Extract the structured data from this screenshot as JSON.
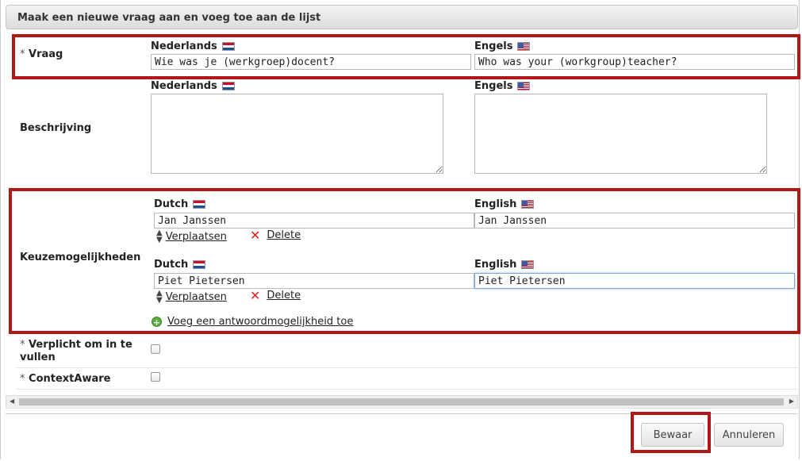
{
  "dialog": {
    "title": "Maak een nieuwe vraag aan en voeg toe aan de lijst"
  },
  "vraag": {
    "required_mark": "*",
    "label": "Vraag",
    "lang_nl": "Nederlands",
    "lang_en": "Engels",
    "value_nl": "Wie was je (werkgroep)docent?",
    "value_en": "Who was your (workgroup)teacher?"
  },
  "beschrijving": {
    "label": "Beschrijving",
    "lang_nl": "Nederlands",
    "lang_en": "Engels",
    "value_nl": "",
    "value_en": ""
  },
  "keuze": {
    "label": "Keuzemogelijkheden",
    "options": [
      {
        "lang_nl": "Dutch",
        "lang_en": "English",
        "value_nl": "Jan Janssen",
        "value_en": "Jan Janssen",
        "move_label": "Verplaatsen",
        "delete_label": "Delete"
      },
      {
        "lang_nl": "Dutch",
        "lang_en": "English",
        "value_nl": "Piet Pietersen",
        "value_en": "Piet Pietersen",
        "move_label": "Verplaatsen",
        "delete_label": "Delete"
      }
    ],
    "add_label": "Voeg een antwoordmogelijkheid toe"
  },
  "verplicht": {
    "required_mark": "*",
    "label": "Verplicht om in te vullen",
    "checked": false
  },
  "context": {
    "required_mark": "*",
    "label": "ContextAware",
    "checked": false
  },
  "footer": {
    "save_label": "Bewaar",
    "cancel_label": "Annuleren"
  },
  "colors": {
    "highlight_border": "#b01818",
    "focus_border": "#7aa7d6"
  }
}
